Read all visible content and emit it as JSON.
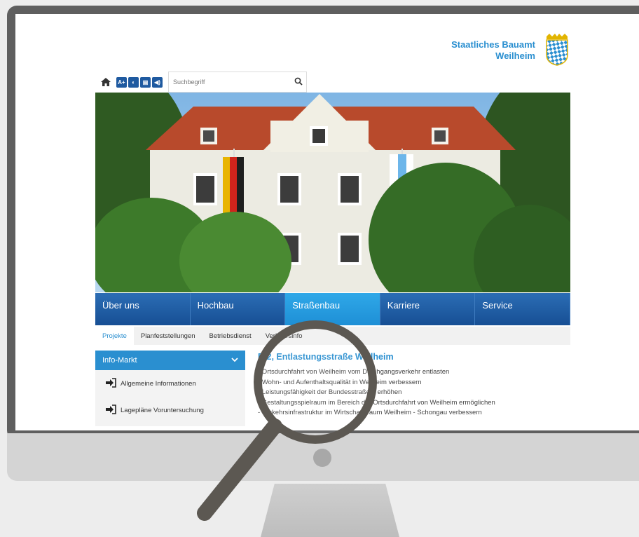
{
  "logo": {
    "line1": "Staatliches Bauamt",
    "line2": "Weilheim"
  },
  "toolbar": {
    "buttons": [
      "A+",
      "◐",
      "▤",
      "◀)"
    ],
    "search_placeholder": "Suchbegriff"
  },
  "nav": {
    "items": [
      {
        "label": "Über uns"
      },
      {
        "label": "Hochbau"
      },
      {
        "label": "Straßenbau"
      },
      {
        "label": "Karriere"
      },
      {
        "label": "Service"
      }
    ],
    "active_index": 2
  },
  "subnav": {
    "items": [
      "Projekte",
      "Planfeststellungen",
      "Betriebsdienst",
      "Verkehrsinfo"
    ]
  },
  "sidebar": {
    "header": "Info-Markt",
    "items": [
      "Allgemeine Informationen",
      "Lagepläne Voruntersuchung"
    ]
  },
  "content": {
    "title": "B 2, Entlastungsstraße Weilheim",
    "lines": [
      "- Ortsdurchfahrt von Weilheim vom Durchgangsverkehr entlasten",
      "- Wohn- und Aufenthaltsqualität in Weilheim verbessern",
      "- Leistungsfähigkeit der Bundesstraße 2 erhöhen",
      "- Gestaltungsspielraum im Bereich der Ortsdurchfahrt von Weilheim ermöglichen",
      "- Verkehrsinfrastruktur im Wirtschaftsraum Weilheim - Schongau verbessern"
    ]
  },
  "colors": {
    "brand_blue": "#1f5aa0",
    "accent_blue": "#2a8fd0"
  }
}
